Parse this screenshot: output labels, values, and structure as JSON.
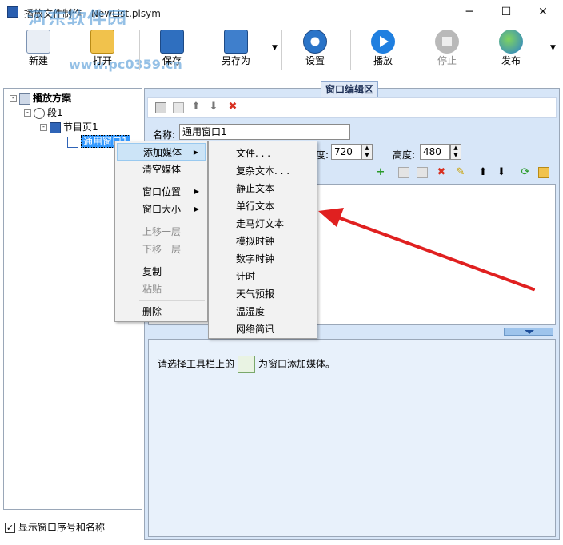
{
  "window": {
    "title": "播放文件制作 - NewList.plsym",
    "controls": {
      "minimize": "─",
      "maximize": "☐",
      "close": "✕"
    },
    "watermark": "河东软件园",
    "watermark_url": "www.pc0359.cn"
  },
  "toolbar": {
    "new": "新建",
    "open": "打开",
    "save": "保存",
    "save_as": "另存为",
    "settings": "设置",
    "play": "播放",
    "stop": "停止",
    "publish": "发布"
  },
  "tree": {
    "root": "播放方案",
    "segment": "段1",
    "page": "节目页1",
    "window": "通用窗口1"
  },
  "show_names_checkbox": {
    "label": "显示窗口序号和名称",
    "checked": true
  },
  "editor": {
    "title": "窗口编辑区",
    "name_label": "名称:",
    "name_value": "通用窗口1",
    "width_label": "度:",
    "width_value": "720",
    "height_label": "高度:",
    "height_value": "480",
    "hint_before": "请选择工具栏上的",
    "hint_after": "为窗口添加媒体。"
  },
  "context_menu": {
    "add_media": "添加媒体",
    "clear_media": "清空媒体",
    "window_position": "窗口位置",
    "window_size": "窗口大小",
    "move_up": "上移一层",
    "move_down": "下移一层",
    "copy": "复制",
    "paste": "粘贴",
    "delete": "删除"
  },
  "submenu": {
    "items": [
      "文件. . .",
      "复杂文本. . .",
      "静止文本",
      "单行文本",
      "走马灯文本",
      "模拟时钟",
      "数字时钟",
      "计时",
      "天气预报",
      "温湿度",
      "网络简讯"
    ]
  },
  "colors": {
    "selection": "#3399ff",
    "panel_bg": "#d7e6f8",
    "arrow": "#e02020",
    "menu_highlight": "#cce4f7"
  }
}
